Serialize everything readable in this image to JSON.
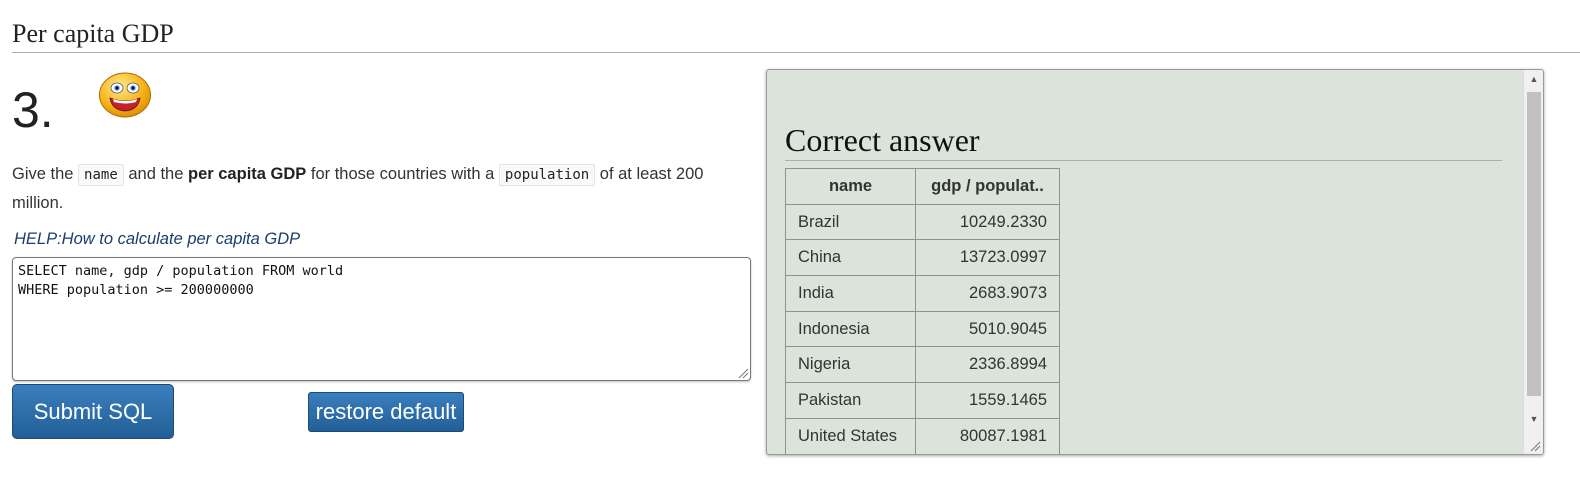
{
  "section": {
    "title": "Per capita GDP"
  },
  "question": {
    "number": "3.",
    "text_parts": {
      "p1": "Give the ",
      "code1": "name",
      "p2": " and the ",
      "bold": "per capita GDP",
      "p3": " for those countries with a ",
      "code2": "population",
      "p4": " of at least 200 million."
    },
    "help_link": "HELP:How to calculate per capita GDP"
  },
  "editor": {
    "sql": "SELECT name, gdp / population FROM world\nWHERE population >= 200000000"
  },
  "buttons": {
    "submit_label": "Submit SQL",
    "restore_label": "restore default"
  },
  "answer": {
    "heading": "Correct answer",
    "columns": [
      "name",
      "gdp / populat.."
    ],
    "rows": [
      {
        "name": "Brazil",
        "value": "10249.2330"
      },
      {
        "name": "China",
        "value": "13723.0997"
      },
      {
        "name": "India",
        "value": "2683.9073"
      },
      {
        "name": "Indonesia",
        "value": "5010.9045"
      },
      {
        "name": "Nigeria",
        "value": "2336.8994"
      },
      {
        "name": "Pakistan",
        "value": "1559.1465"
      },
      {
        "name": "United States",
        "value": "80087.1981"
      }
    ]
  },
  "colors": {
    "button_blue": "#2d6ea8",
    "answer_background": "#dae4da",
    "help_link": "#1a3d6d"
  },
  "icons": {
    "smiley": "smiley-face-icon",
    "scroll_up": "scroll-up-arrow-icon",
    "scroll_down": "scroll-down-arrow-icon",
    "resize": "resize-grip-icon"
  }
}
